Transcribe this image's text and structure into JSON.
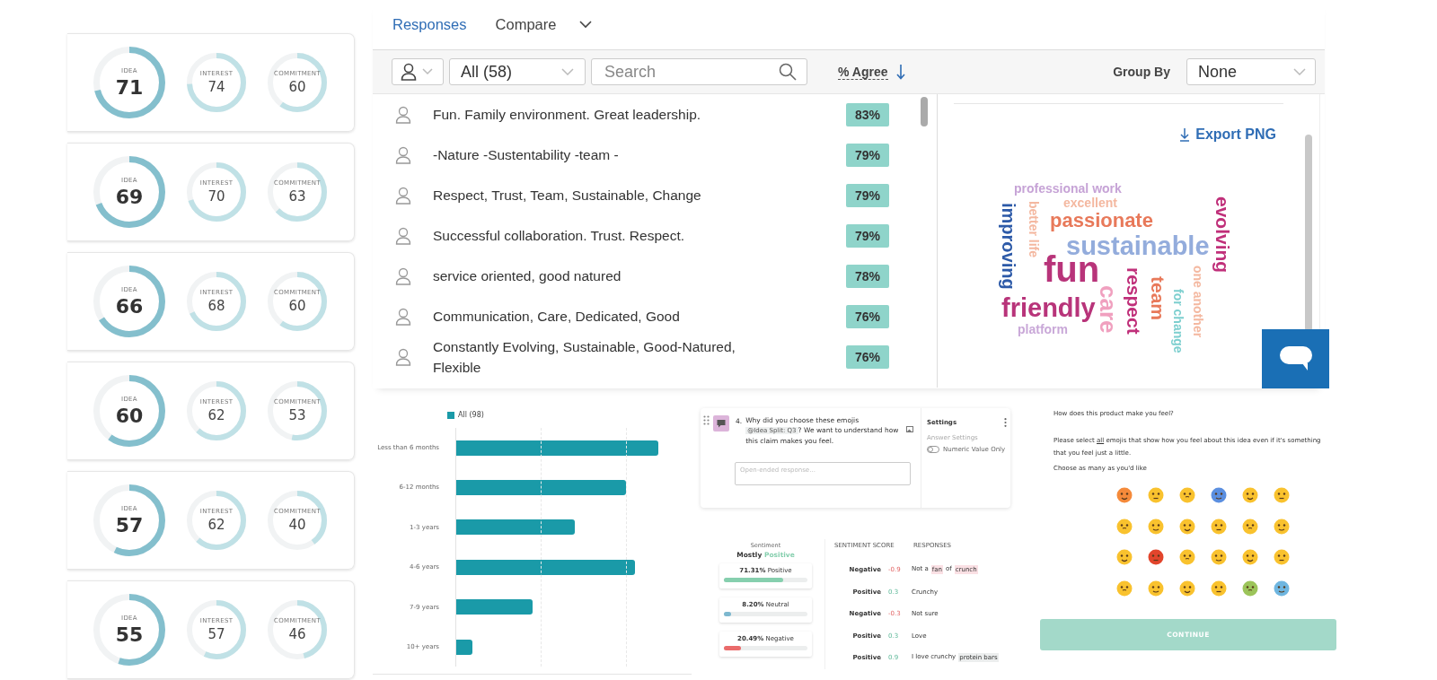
{
  "score_cards": [
    {
      "metrics": [
        {
          "kind": "primary",
          "label": "IDEA",
          "value": "71",
          "level": 0.71
        },
        {
          "kind": "secondary",
          "label": "INTEREST",
          "value": "74",
          "level": 0.74
        },
        {
          "kind": "secondary",
          "label": "COMMITMENT",
          "value": "60",
          "level": 0.6
        }
      ]
    },
    {
      "metrics": [
        {
          "kind": "primary",
          "label": "IDEA",
          "value": "69",
          "level": 0.69
        },
        {
          "kind": "secondary",
          "label": "INTEREST",
          "value": "70",
          "level": 0.7
        },
        {
          "kind": "secondary",
          "label": "COMMITMENT",
          "value": "63",
          "level": 0.63
        }
      ]
    },
    {
      "metrics": [
        {
          "kind": "primary",
          "label": "IDEA",
          "value": "66",
          "level": 0.66
        },
        {
          "kind": "secondary",
          "label": "INTEREST",
          "value": "68",
          "level": 0.68
        },
        {
          "kind": "secondary",
          "label": "COMMITMENT",
          "value": "60",
          "level": 0.6
        }
      ]
    },
    {
      "metrics": [
        {
          "kind": "primary",
          "label": "IDEA",
          "value": "60",
          "level": 0.6
        },
        {
          "kind": "secondary",
          "label": "INTEREST",
          "value": "62",
          "level": 0.62
        },
        {
          "kind": "secondary",
          "label": "COMMITMENT",
          "value": "53",
          "level": 0.53
        }
      ]
    },
    {
      "metrics": [
        {
          "kind": "primary",
          "label": "IDEA",
          "value": "57",
          "level": 0.57
        },
        {
          "kind": "secondary",
          "label": "INTEREST",
          "value": "62",
          "level": 0.62
        },
        {
          "kind": "secondary",
          "label": "COMMITMENT",
          "value": "40",
          "level": 0.4
        }
      ]
    },
    {
      "metrics": [
        {
          "kind": "primary",
          "label": "IDEA",
          "value": "55",
          "level": 0.55
        },
        {
          "kind": "secondary",
          "label": "INTEREST",
          "value": "57",
          "level": 0.57
        },
        {
          "kind": "secondary",
          "label": "COMMITMENT",
          "value": "46",
          "level": 0.46
        }
      ]
    }
  ],
  "responses_panel": {
    "tabs": [
      {
        "label": "Responses",
        "selected": true
      },
      {
        "label": "Compare",
        "selected": false
      }
    ],
    "filter": {
      "value": "All (58)"
    },
    "search": {
      "placeholder": "Search"
    },
    "sort": {
      "label": "% Agree"
    },
    "group_by": {
      "label": "Group By",
      "value": "None"
    },
    "responses": [
      {
        "text": "Fun. Family environment. Great leadership.",
        "agree": "83%"
      },
      {
        "text": "-Nature -Sustentability -team -",
        "agree": "79%"
      },
      {
        "text": "Respect, Trust, Team, Sustainable, Change",
        "agree": "79%"
      },
      {
        "text": "Successful collaboration. Trust. Respect.",
        "agree": "79%"
      },
      {
        "text": "service oriented, good natured",
        "agree": "78%"
      },
      {
        "text": "Communication, Care, Dedicated, Good",
        "agree": "76%"
      },
      {
        "text": "Constantly Evolving, Sustainable, Good-Natured, Flexible",
        "agree": "76%"
      }
    ],
    "word_cloud": {
      "export_label": "Export PNG",
      "words": [
        {
          "text": "professional work",
          "color": "#c6a3d6",
          "kind": "horizontal"
        },
        {
          "text": "excellent",
          "color": "#f4b8a0",
          "kind": "horizontal"
        },
        {
          "text": "passionate",
          "color": "#e8795a",
          "kind": "horizontal"
        },
        {
          "text": "sustainable",
          "color": "#93acdc",
          "kind": "horizontal"
        },
        {
          "text": "fun",
          "color": "#b8347a",
          "kind": "horizontal"
        },
        {
          "text": "friendly",
          "color": "#b8347a",
          "kind": "horizontal"
        },
        {
          "text": "platform",
          "color": "#c9a8d8",
          "kind": "horizontal"
        },
        {
          "text": "improving",
          "color": "#2d5aa8",
          "kind": "vertical"
        },
        {
          "text": "better life",
          "color": "#f4b8a0",
          "kind": "vertical"
        },
        {
          "text": "care",
          "color": "#f0a0bf",
          "kind": "vertical"
        },
        {
          "text": "respect",
          "color": "#c0307a",
          "kind": "vertical"
        },
        {
          "text": "team",
          "color": "#e8795a",
          "kind": "vertical"
        },
        {
          "text": "for change",
          "color": "#7dcfcf",
          "kind": "vertical"
        },
        {
          "text": "one another",
          "color": "#f4b8a0",
          "kind": "vertical"
        },
        {
          "text": "evolving",
          "color": "#c0307a",
          "kind": "vertical"
        }
      ]
    }
  },
  "bar_panel": {
    "legend": "All (98)",
    "categories": [
      "Less than 6 months",
      "6-12 months",
      "1-3 years",
      "4-6 years",
      "7-9 years",
      "10+ years"
    ]
  },
  "question_card": {
    "number": "4.",
    "text_before": "Why did you choose these emojis",
    "tag": "@Idea Split: Q3",
    "text_after": "? We want to understand how this claim makes you feel.",
    "placeholder": "Open-ended response...",
    "settings_title": "Settings",
    "settings_subtitle": "Answer Settings",
    "toggle": {
      "label": "Numeric Value Only",
      "on": false
    }
  },
  "sentiment": {
    "title": "Sentiment",
    "summary_prefix": "Mostly",
    "summary_value": "Positive",
    "distribution": [
      {
        "kind": "positive",
        "label": "**71.31%** Positive",
        "level": 0.7131
      },
      {
        "kind": "neutral",
        "label": "**8.20%** Neutral",
        "level": 0.082
      },
      {
        "kind": "negative",
        "label": "**20.49%** Negative",
        "level": 0.2049
      }
    ],
    "columns": [
      "SENTIMENT SCORE",
      "RESPONSES"
    ],
    "rows": [
      {
        "kind": "negative",
        "label": "Negative",
        "score": "-0.9",
        "parts": [
          {
            "text": "Not a",
            "highlight": false
          },
          {
            "text": "fan",
            "highlight": true
          },
          {
            "text": "of",
            "highlight": false
          },
          {
            "text": "crunch",
            "highlight": true
          }
        ]
      },
      {
        "kind": "positive",
        "label": "Positive",
        "score": "0.3",
        "parts": [
          {
            "text": "Crunchy",
            "highlight": false
          }
        ]
      },
      {
        "kind": "negative",
        "label": "Negative",
        "score": "-0.3",
        "parts": [
          {
            "text": "Not sure",
            "highlight": false
          }
        ]
      },
      {
        "kind": "positive",
        "label": "Positive",
        "score": "0.3",
        "parts": [
          {
            "text": "Love",
            "highlight": false
          }
        ]
      },
      {
        "kind": "positive",
        "label": "Positive",
        "score": "0.9",
        "parts": [
          {
            "text": "I love crunchy",
            "highlight": false
          },
          {
            "text": "protein bars",
            "highlight": true
          }
        ]
      }
    ]
  },
  "emoji_question": {
    "title": "How does this product make you feel?",
    "instruction_before": "Please select ",
    "instruction_underlined": "all",
    "instruction_after": " emojis that show how you feel about this idea even if it's something that you feel just a little.",
    "hint": "Choose as many as you'd like",
    "button": "CONTINUE"
  }
}
